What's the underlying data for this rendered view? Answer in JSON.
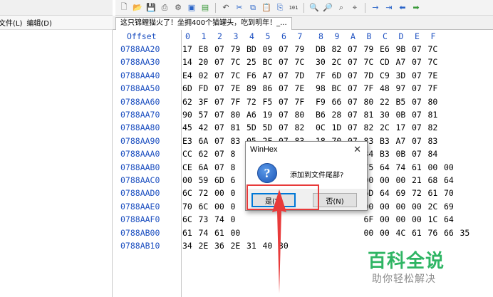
{
  "left_menu": {
    "file": "文件(L)",
    "edit": "编辑(D)"
  },
  "tab": {
    "title": "这只锦鲤猫火了！坐拥400个猫罐头，吃到明年！_..."
  },
  "hex": {
    "offset_label": "Offset",
    "columns": [
      "0",
      "1",
      "2",
      "3",
      "4",
      "5",
      "6",
      "7",
      "8",
      "9",
      "A",
      "B",
      "C",
      "D",
      "E",
      "F"
    ],
    "rows": [
      {
        "offset": "0788AA20",
        "bytes": [
          "17",
          "E8",
          "07",
          "79",
          "BD",
          "09",
          "07",
          "79",
          "DB",
          "82",
          "07",
          "79",
          "E6",
          "9B",
          "07",
          "7C"
        ]
      },
      {
        "offset": "0788AA30",
        "bytes": [
          "14",
          "20",
          "07",
          "7C",
          "25",
          "BC",
          "07",
          "7C",
          "30",
          "2C",
          "07",
          "7C",
          "CD",
          "A7",
          "07",
          "7C"
        ]
      },
      {
        "offset": "0788AA40",
        "bytes": [
          "E4",
          "02",
          "07",
          "7C",
          "F6",
          "A7",
          "07",
          "7D",
          "7F",
          "6D",
          "07",
          "7D",
          "C9",
          "3D",
          "07",
          "7E"
        ]
      },
      {
        "offset": "0788AA50",
        "bytes": [
          "6D",
          "FD",
          "07",
          "7E",
          "89",
          "86",
          "07",
          "7E",
          "98",
          "BC",
          "07",
          "7F",
          "48",
          "97",
          "07",
          "7F"
        ]
      },
      {
        "offset": "0788AA60",
        "bytes": [
          "62",
          "3F",
          "07",
          "7F",
          "72",
          "F5",
          "07",
          "7F",
          "F9",
          "66",
          "07",
          "80",
          "22",
          "B5",
          "07",
          "80"
        ]
      },
      {
        "offset": "0788AA70",
        "bytes": [
          "90",
          "57",
          "07",
          "80",
          "A6",
          "19",
          "07",
          "80",
          "B6",
          "28",
          "07",
          "81",
          "30",
          "0B",
          "07",
          "81"
        ]
      },
      {
        "offset": "0788AA80",
        "bytes": [
          "45",
          "42",
          "07",
          "81",
          "5D",
          "5D",
          "07",
          "82",
          "0C",
          "1D",
          "07",
          "82",
          "2C",
          "17",
          "07",
          "82"
        ]
      },
      {
        "offset": "0788AA90",
        "bytes": [
          "E3",
          "6A",
          "07",
          "83",
          "05",
          "2F",
          "07",
          "83",
          "18",
          "70",
          "07",
          "83",
          "B3",
          "A7",
          "07",
          "83"
        ]
      },
      {
        "offset": "0788AAA0",
        "bytes": [
          "CC",
          "62",
          "07",
          "8",
          "",
          "",
          "",
          "",
          "",
          "",
          "",
          "84",
          "B3",
          "0B",
          "07",
          "84"
        ]
      },
      {
        "offset": "0788AAB0",
        "bytes": [
          "CE",
          "6A",
          "07",
          "8",
          "",
          "",
          "",
          "",
          "",
          "",
          "",
          "75",
          "64",
          "74",
          "61",
          "00",
          "00"
        ]
      },
      {
        "offset": "0788AAC0",
        "bytes": [
          "00",
          "59",
          "6D",
          "6",
          "",
          "",
          "",
          "",
          "",
          "",
          "",
          "00",
          "00",
          "00",
          "21",
          "68",
          "64"
        ]
      },
      {
        "offset": "0788AAD0",
        "bytes": [
          "6C",
          "72",
          "00",
          "0",
          "",
          "",
          "",
          "",
          "",
          "",
          "",
          "6D",
          "64",
          "69",
          "72",
          "61",
          "70"
        ]
      },
      {
        "offset": "0788AAE0",
        "bytes": [
          "70",
          "6C",
          "00",
          "0",
          "",
          "",
          "",
          "",
          "",
          "",
          "",
          "00",
          "00",
          "00",
          "00",
          "2C",
          "69"
        ]
      },
      {
        "offset": "0788AAF0",
        "bytes": [
          "6C",
          "73",
          "74",
          "0",
          "",
          "",
          "",
          "",
          "",
          "",
          "",
          "6F",
          "00",
          "00",
          "00",
          "1C",
          "64"
        ]
      },
      {
        "offset": "0788AB00",
        "bytes": [
          "61",
          "74",
          "61",
          "00",
          "",
          "",
          "",
          "",
          "",
          "",
          "",
          "00",
          "00",
          "4C",
          "61",
          "76",
          "66",
          "35"
        ]
      },
      {
        "offset": "0788AB10",
        "bytes": [
          "34",
          "2E",
          "36",
          "2E",
          "31",
          "40",
          "30"
        ]
      }
    ]
  },
  "dialog": {
    "title": "WinHex",
    "close": "✕",
    "message": "添加到文件尾部?",
    "yes_label": "是(Y)",
    "no_label": "否(N)"
  },
  "watermark": {
    "main": "百科全说",
    "sub": "助你轻松解决"
  },
  "colors": {
    "offset_blue": "#1c4fc0",
    "highlight_red": "#e83a3a",
    "watermark_green": "#2fb564"
  }
}
